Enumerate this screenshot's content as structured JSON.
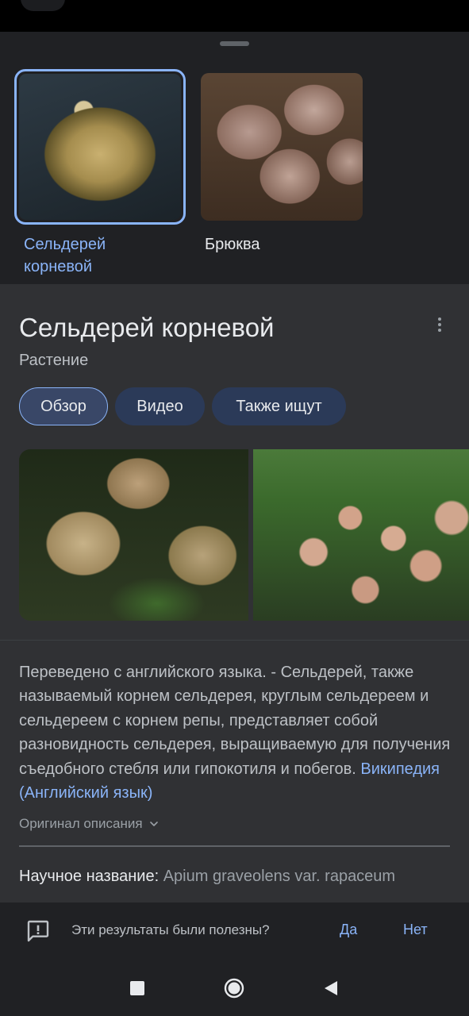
{
  "carousel": {
    "items": [
      {
        "label": "Сельдерей корневой",
        "selected": true
      },
      {
        "label": "Брюква",
        "selected": false
      }
    ]
  },
  "entity": {
    "title": "Сельдерей корневой",
    "subtitle": "Растение",
    "menu_icon": "more-vert-icon"
  },
  "tabs": [
    {
      "label": "Обзор",
      "active": true
    },
    {
      "label": "Видео",
      "active": false
    },
    {
      "label": "Также ищут",
      "active": false
    }
  ],
  "description": {
    "text": "Переведено с английского языка. - Сельдерей, также называемый корнем сельдерея, круглым сельдереем и сельдереем с корнем репы, представляет собой разновидность сельдерея, выращиваемую для получения съедобного стебля или гипокотиля и побегов.",
    "source": "Википедия (Английский язык)",
    "original_toggle": "Оригинал описания"
  },
  "facts": {
    "scientific_name_label": "Научное название:",
    "scientific_name_value": "Apium graveolens var. rapaceum"
  },
  "feedback": {
    "question": "Эти результаты были полезны?",
    "yes": "Да",
    "no": "Нет",
    "icon": "feedback-icon"
  },
  "nav": {
    "recent_icon": "square-icon",
    "home_icon": "circle-icon",
    "back_icon": "triangle-back-icon"
  },
  "colors": {
    "accent": "#8ab4f8",
    "chip_bg": "#2b3a58",
    "sheet_bg": "#303134",
    "carousel_bg": "#202124"
  }
}
